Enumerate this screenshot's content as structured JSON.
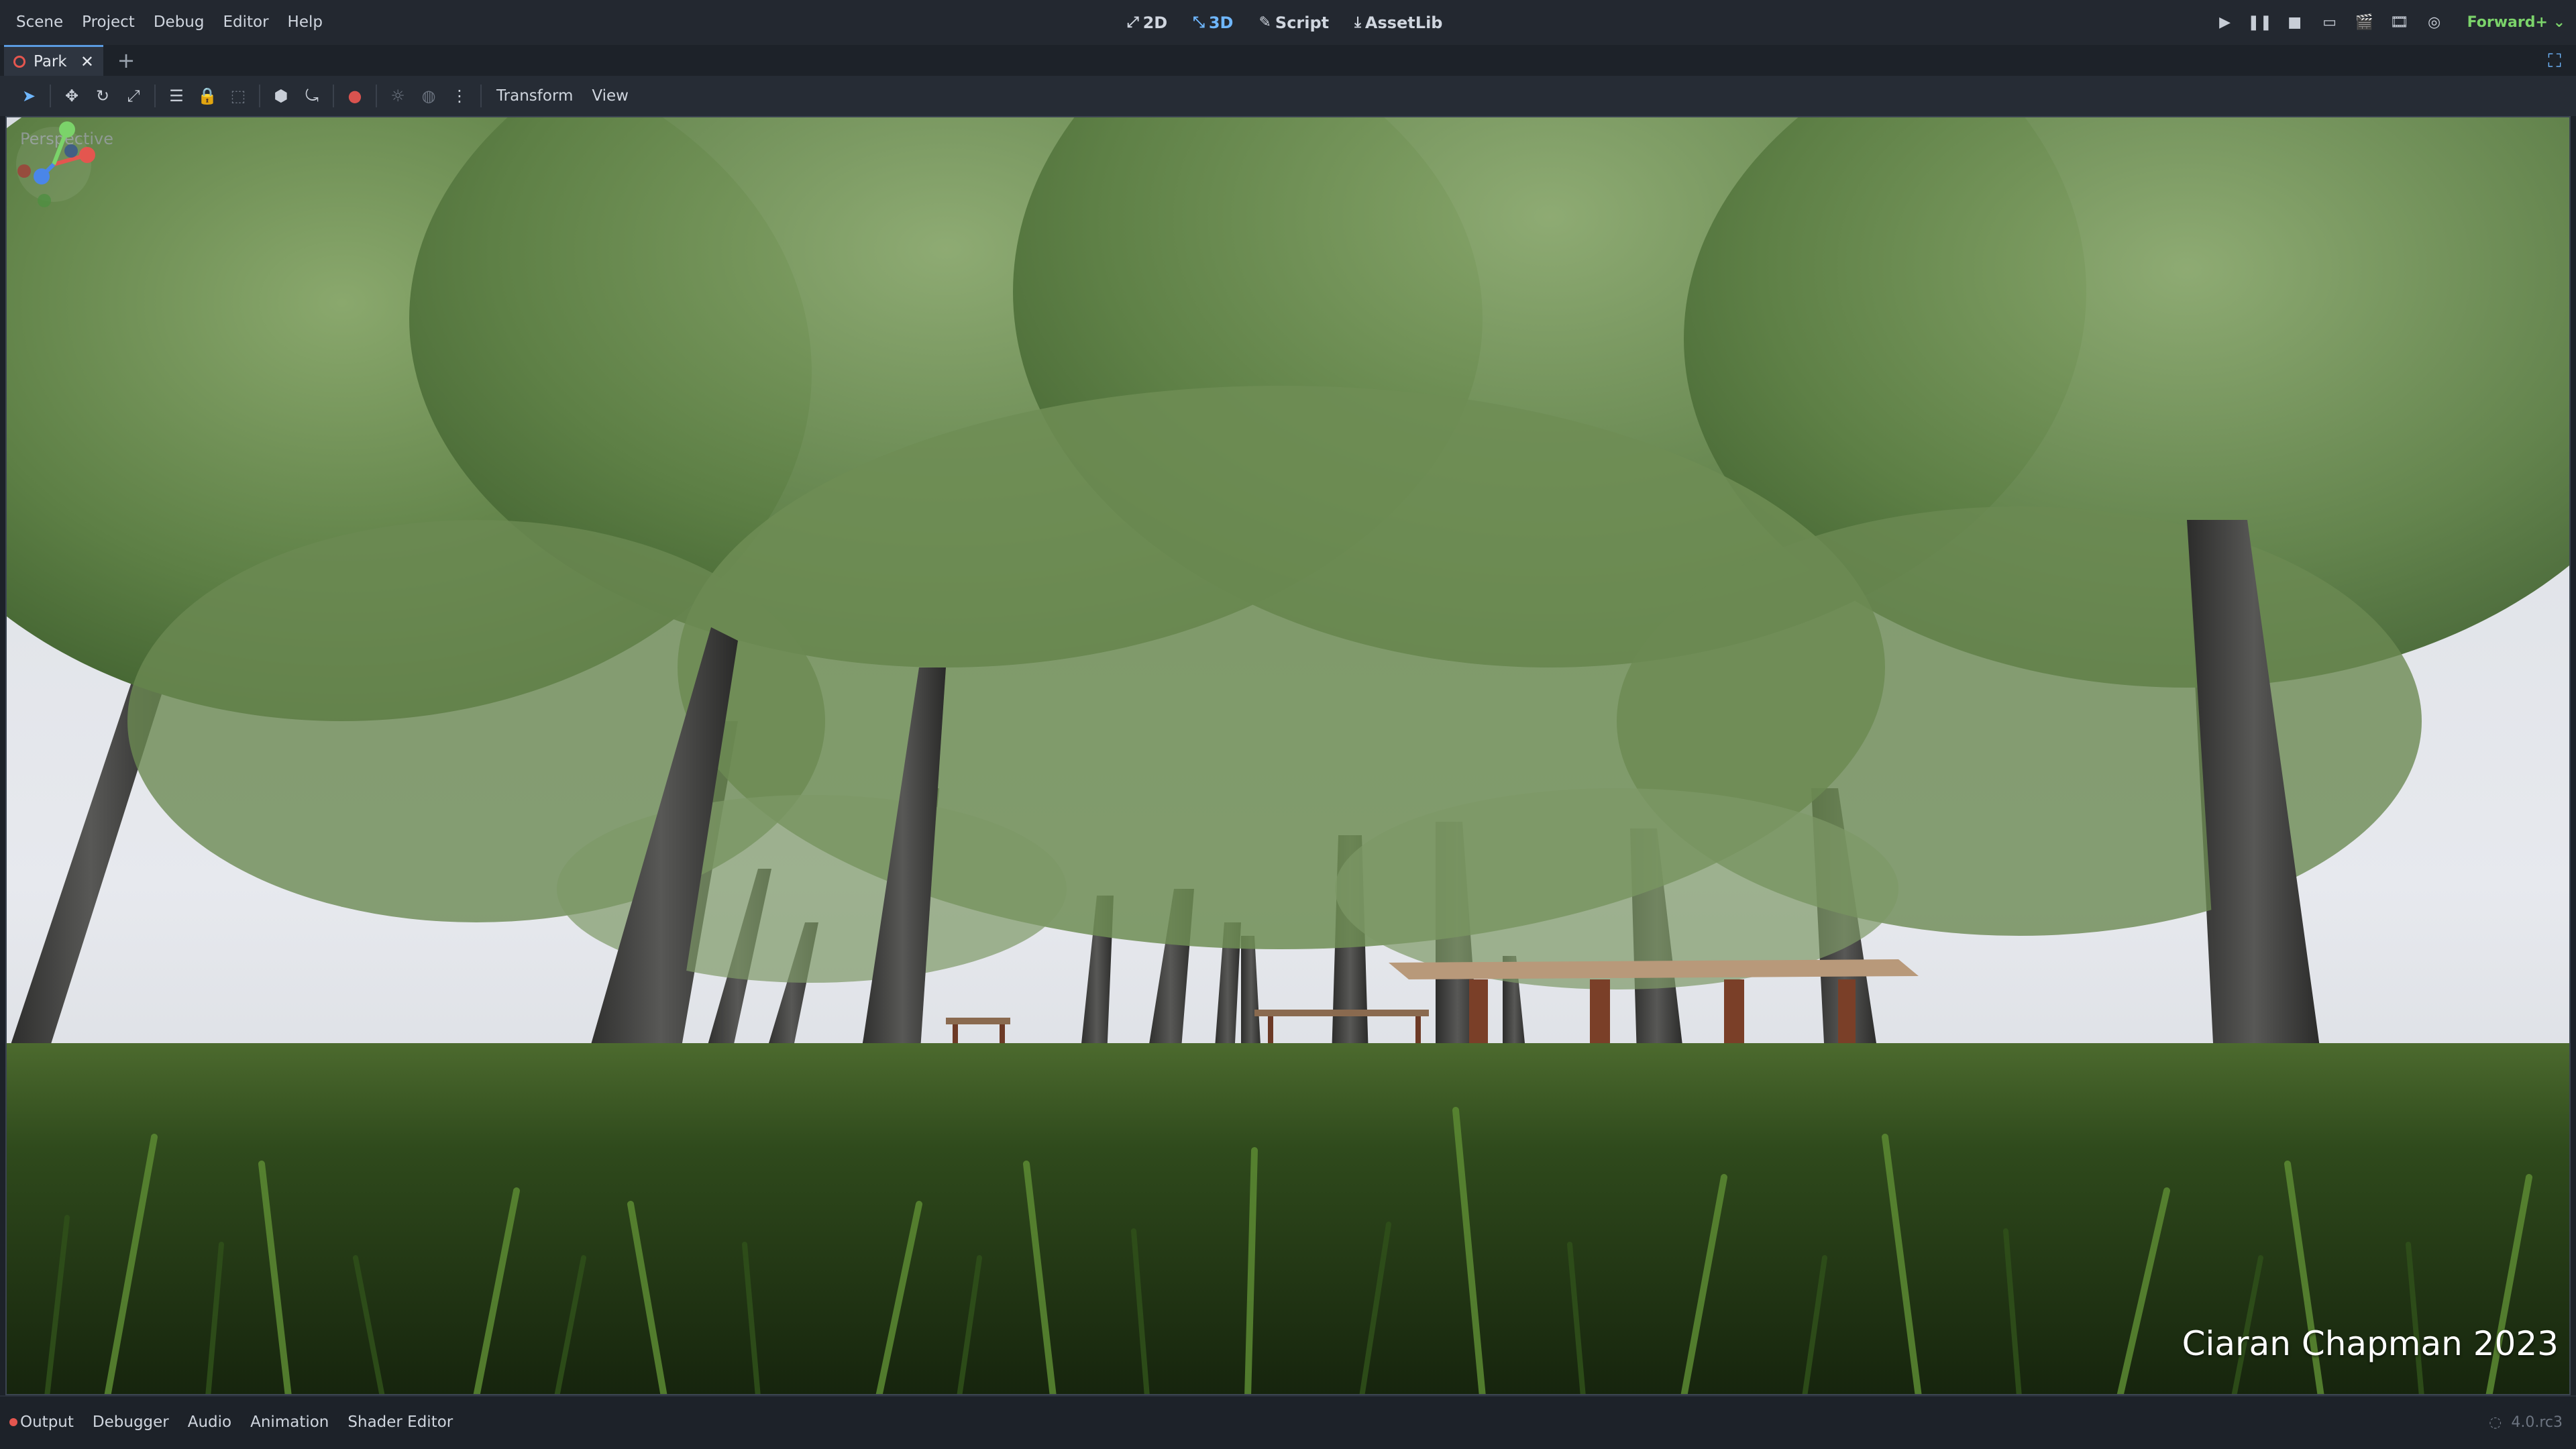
{
  "menu": {
    "items": [
      "Scene",
      "Project",
      "Debug",
      "Editor",
      "Help"
    ]
  },
  "workspaces": [
    {
      "label": "2D",
      "icon": "2d-icon",
      "active": false
    },
    {
      "label": "3D",
      "icon": "3d-icon",
      "active": true
    },
    {
      "label": "Script",
      "icon": "script-icon",
      "active": false
    },
    {
      "label": "AssetLib",
      "icon": "assetlib-icon",
      "active": false
    }
  ],
  "run": {
    "renderer": "Forward+"
  },
  "tabs": [
    {
      "label": "Park"
    }
  ],
  "toolbar": {
    "transform_menu": "Transform",
    "view_menu": "View"
  },
  "viewport": {
    "label": "Perspective",
    "watermark": "Ciaran Chapman 2023"
  },
  "bottom_panels": [
    "Output",
    "Debugger",
    "Audio",
    "Animation",
    "Shader Editor"
  ],
  "status": {
    "version": "4.0.rc3"
  },
  "colors": {
    "accent": "#6fb7ff",
    "renderer_green": "#7bd36a",
    "error_red": "#e4564f",
    "panel_bg": "#1d2229"
  }
}
